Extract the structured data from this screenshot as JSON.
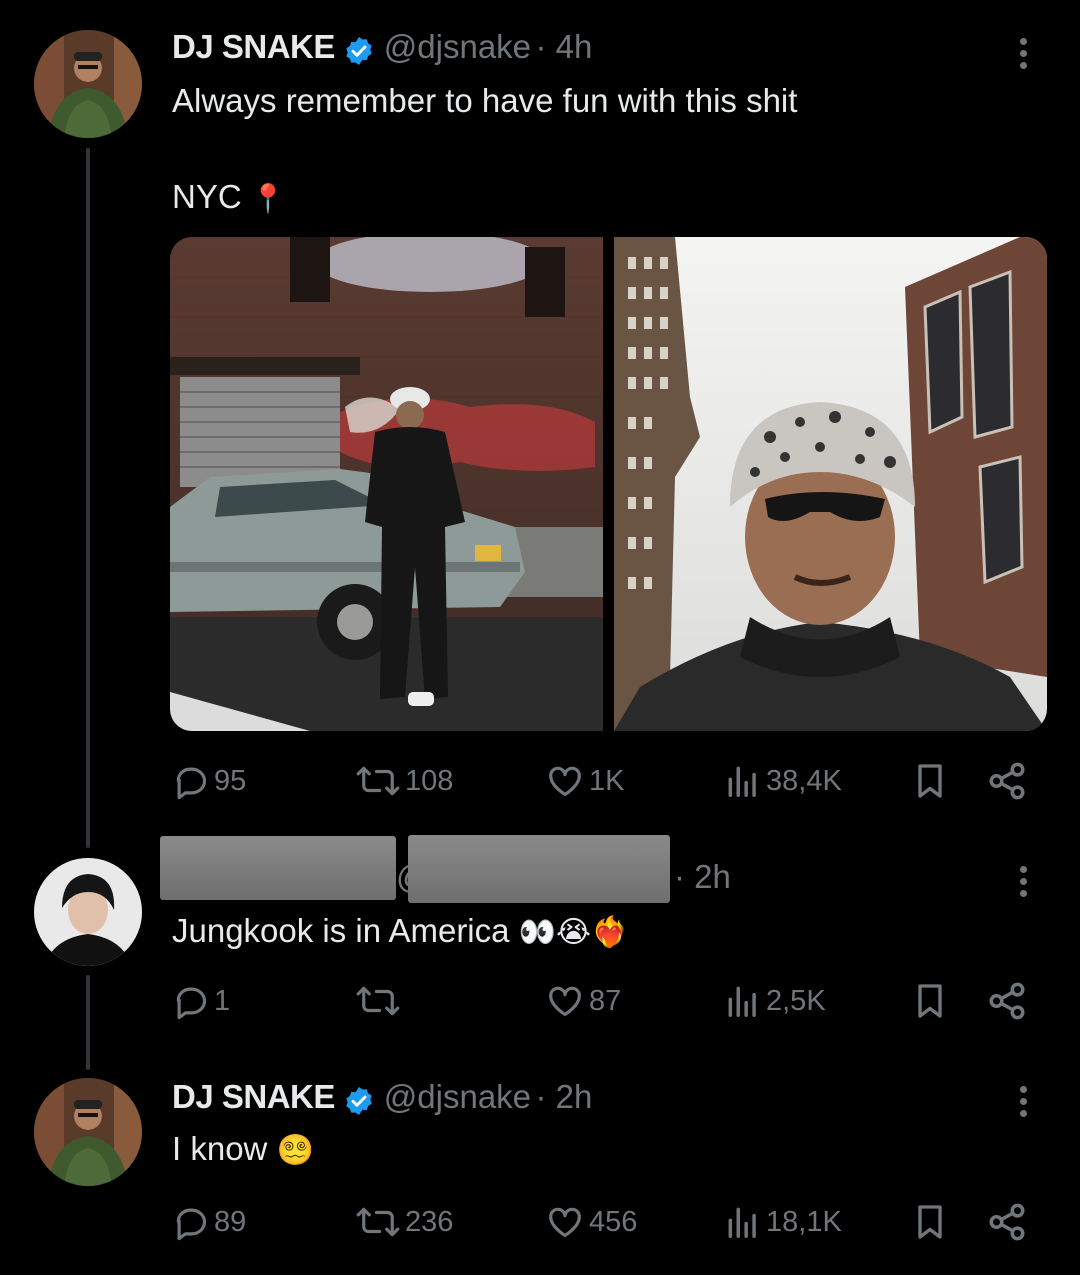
{
  "tweet1": {
    "name": "DJ SNAKE",
    "handle": "@djsnake",
    "time": "· 4h",
    "line1": "Always remember to have fun with this shit",
    "line2": "NYC",
    "pin_emoji": "📍",
    "stats": {
      "replies": "95",
      "retweets": "108",
      "likes": "1K",
      "views": "38,4K"
    }
  },
  "tweet2": {
    "handle_visible_char": "@",
    "time": "· 2h",
    "text": "Jungkook is in America",
    "emojis": "👀😭❤️‍🔥",
    "stats": {
      "replies": "1",
      "retweets": "",
      "likes": "87",
      "views": "2,5K"
    }
  },
  "tweet3": {
    "name": "DJ SNAKE",
    "handle": "@djsnake",
    "time": "· 2h",
    "text": "I know",
    "emoji": "😵‍💫",
    "stats": {
      "replies": "89",
      "retweets": "236",
      "likes": "456",
      "views": "18,1K"
    }
  },
  "colors": {
    "background": "#000000",
    "text": "#e7e9ea",
    "muted": "#71767b",
    "verified": "#1d9bf0",
    "line": "#333639"
  },
  "icons": [
    "reply-icon",
    "retweet-icon",
    "like-icon",
    "views-icon",
    "bookmark-icon",
    "share-icon",
    "verified-badge-icon",
    "more-icon"
  ]
}
